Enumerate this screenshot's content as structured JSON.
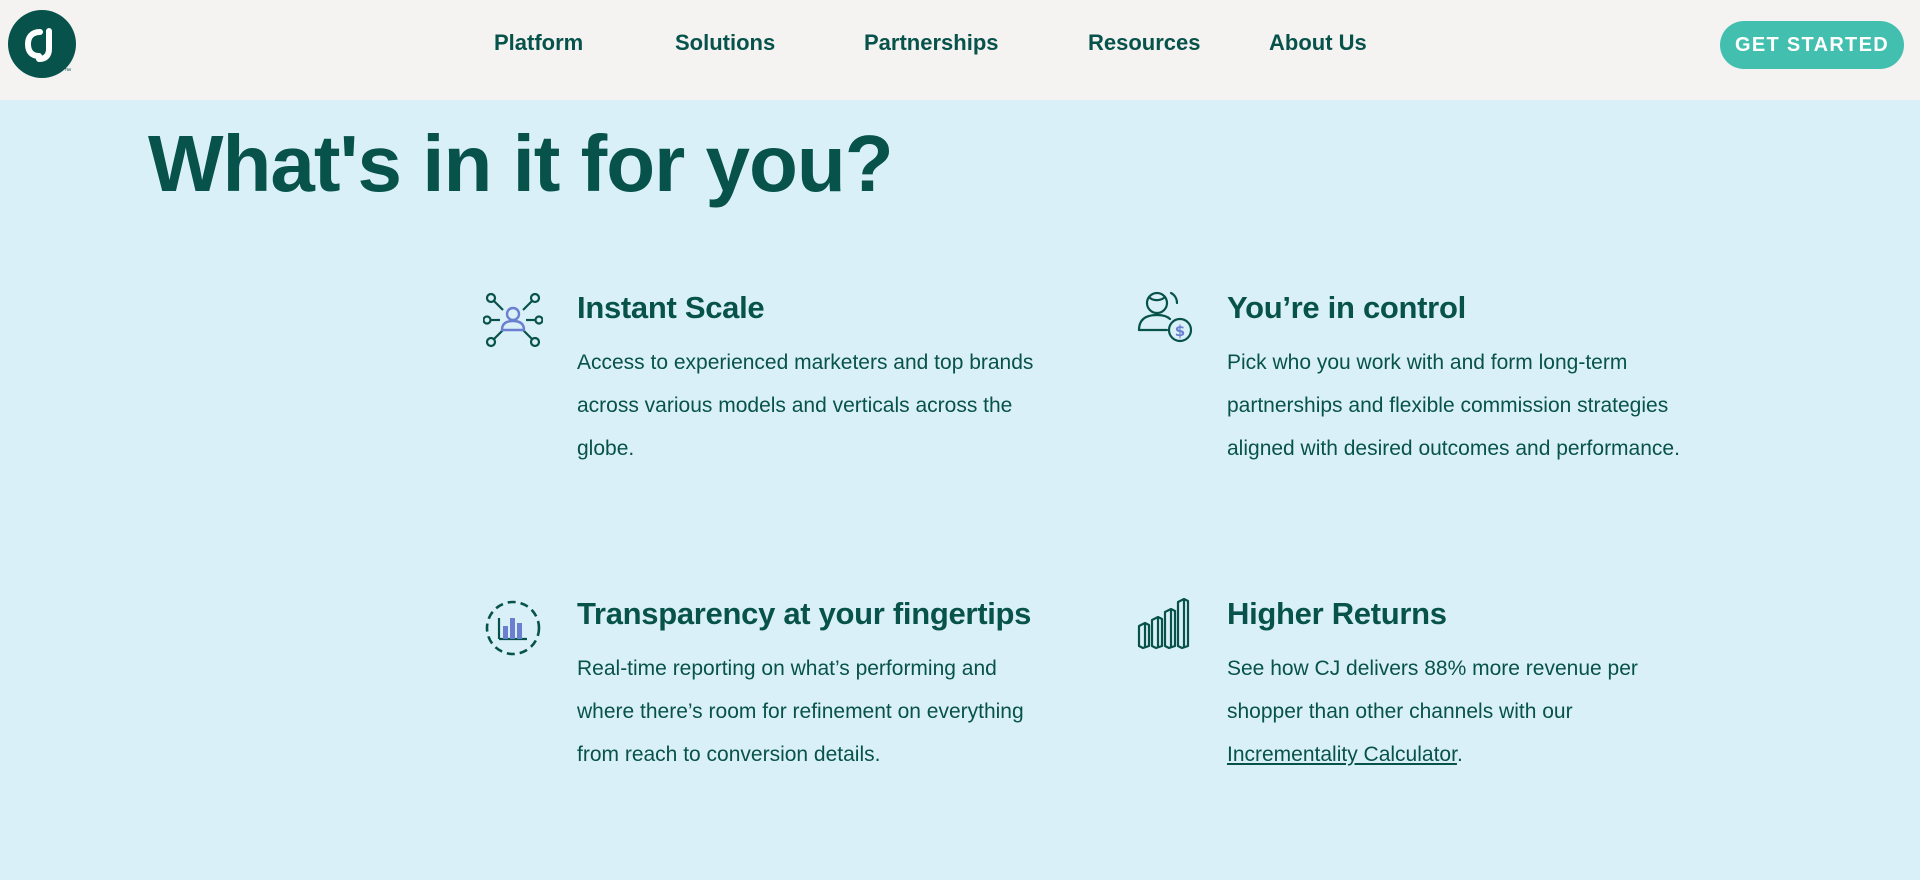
{
  "header": {
    "logo_text": "CJ",
    "logo_trademark": "™",
    "nav": [
      "Platform",
      "Solutions",
      "Partnerships",
      "Resources",
      "About Us"
    ],
    "cta_label": "GET STARTED"
  },
  "section": {
    "title": "What's in it for you?",
    "features": [
      {
        "icon": "network-people-icon",
        "title": "Instant Scale",
        "description": "Access to experienced marketers and top brands across various models and verticals across the globe."
      },
      {
        "icon": "person-dollar-icon",
        "title": "You’re in control",
        "description": "Pick who you work with and form long-term partnerships and flexible commission strategies aligned with desired outcomes and performance."
      },
      {
        "icon": "bar-chart-circle-icon",
        "title": "Transparency at your fingertips",
        "description": "Real-time reporting on what’s performing and where there’s room for refinement on everything from reach to conversion details."
      },
      {
        "icon": "rising-bars-icon",
        "title": "Higher Returns",
        "description_prefix": "See how CJ delivers 88% more revenue per shopper than other channels with our ",
        "link_label": "Incrementality Calculator",
        "description_suffix": "."
      }
    ]
  },
  "colors": {
    "brand_dark": "#07524a",
    "accent": "#42bfae",
    "icon_accent": "#6a7fd0",
    "section_bg": "#daf0f8",
    "header_bg": "#f4f3f1"
  }
}
